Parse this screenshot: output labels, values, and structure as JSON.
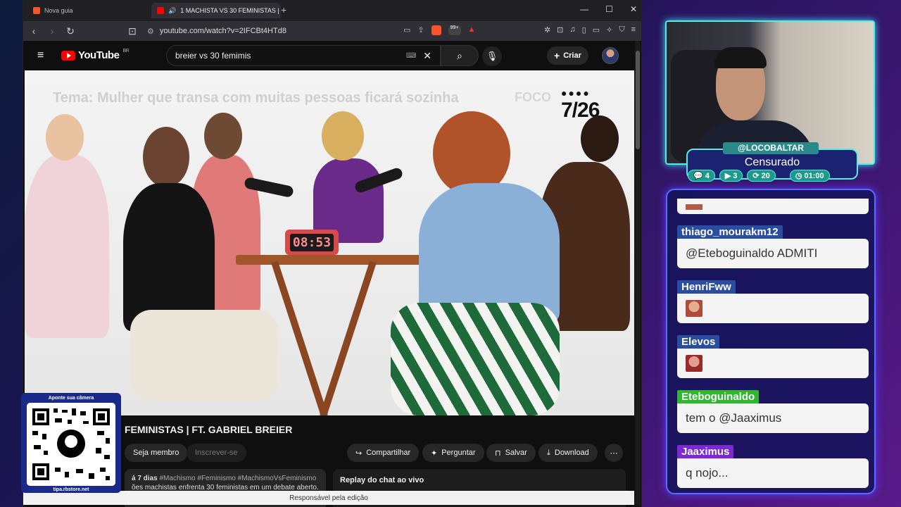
{
  "browser": {
    "tabs": [
      {
        "label": "Nova guia"
      },
      {
        "label": "1 MACHISTA VS 30 FEMINISTAS | FT"
      }
    ],
    "url": "youtube.com/watch?v=2IFCBt4HTd8",
    "brave_badge_count": "99+"
  },
  "youtube": {
    "logo": "YouTube",
    "region": "BR",
    "search_value": "breier vs 30 femimis",
    "create_label": "Criar",
    "video": {
      "overlay_topic": "Tema: Mulher que transa com muitas pessoas ficará sozinha",
      "brand": "FOCO",
      "counter": "7/26",
      "timer": "08:53"
    },
    "title": "FEMINISTAS | FT. GABRIEL BREIER",
    "actions": {
      "member": "Seja membro",
      "subscribe": "Inscrever-se",
      "share": "Compartilhar",
      "ask": "Perguntar",
      "save": "Salvar",
      "download": "Download"
    },
    "description": {
      "meta": "á 7 dias",
      "tags": "#Machismo #Feminismo #MachismoVsFeminismo",
      "snippet": "ões machistas enfrenta 30 feministas em um debate aberto. o"
    },
    "replay": "Replay do chat ao vivo",
    "footer": "Responsável pela edição"
  },
  "qr": {
    "caption": "Aponte sua câmera",
    "footer": "tipa.rbstore.net"
  },
  "streamer": {
    "name": "@LOCOBALTAR",
    "status": "Censurado",
    "stats": [
      {
        "icon": "chat-icon",
        "value": "4"
      },
      {
        "icon": "video-icon",
        "value": "3"
      },
      {
        "icon": "sync-icon",
        "value": "20"
      },
      {
        "icon": "clock-icon",
        "value": "01:00"
      }
    ]
  },
  "chat": {
    "messages": [
      {
        "user": "thiago_mourakm12",
        "text": "@Eteboguinaldo ADMITI",
        "color": "#2a4da0"
      },
      {
        "user": "HenriFww",
        "text": "",
        "color": "#2a4da0"
      },
      {
        "user": "Elevos",
        "text": "",
        "color": "#2a4da0"
      },
      {
        "user": "Eteboguinaldo",
        "text": "tem o @Jaaximus",
        "color": "#2fb82f"
      },
      {
        "user": "Jaaximus",
        "text": "q nojo...",
        "color": "#7a2ad0"
      }
    ]
  }
}
